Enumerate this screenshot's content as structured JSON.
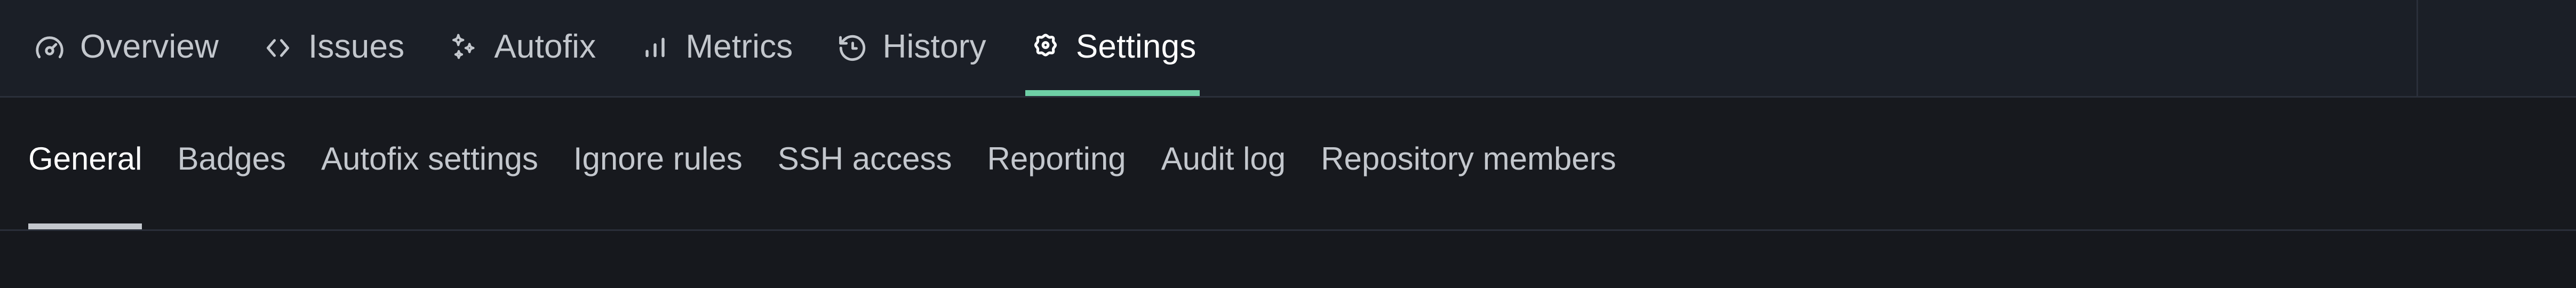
{
  "theme": {
    "primary_nav_bg": "#1b1f27",
    "secondary_nav_bg": "#17191e",
    "content_bg": "#16181d",
    "divider": "#2a2f3a",
    "muted_text": "#c3c7cd",
    "active_text": "#ffffff",
    "active_accent": "#6ecfa6",
    "secondary_active_accent": "#c3c7cd"
  },
  "primary_nav": {
    "active_index": 5,
    "tabs": [
      {
        "label": "Overview",
        "icon": "gauge-icon",
        "active": false
      },
      {
        "label": "Issues",
        "icon": "code-brackets-icon",
        "active": false
      },
      {
        "label": "Autofix",
        "icon": "sparkles-icon",
        "active": false
      },
      {
        "label": "Metrics",
        "icon": "bar-chart-icon",
        "active": false
      },
      {
        "label": "History",
        "icon": "history-clock-icon",
        "active": false
      },
      {
        "label": "Settings",
        "icon": "gear-icon",
        "active": true
      }
    ]
  },
  "secondary_nav": {
    "active_index": 0,
    "tabs": [
      {
        "label": "General",
        "active": true
      },
      {
        "label": "Badges",
        "active": false
      },
      {
        "label": "Autofix settings",
        "active": false
      },
      {
        "label": "Ignore rules",
        "active": false
      },
      {
        "label": "SSH access",
        "active": false
      },
      {
        "label": "Reporting",
        "active": false
      },
      {
        "label": "Audit log",
        "active": false
      },
      {
        "label": "Repository members",
        "active": false
      }
    ]
  }
}
